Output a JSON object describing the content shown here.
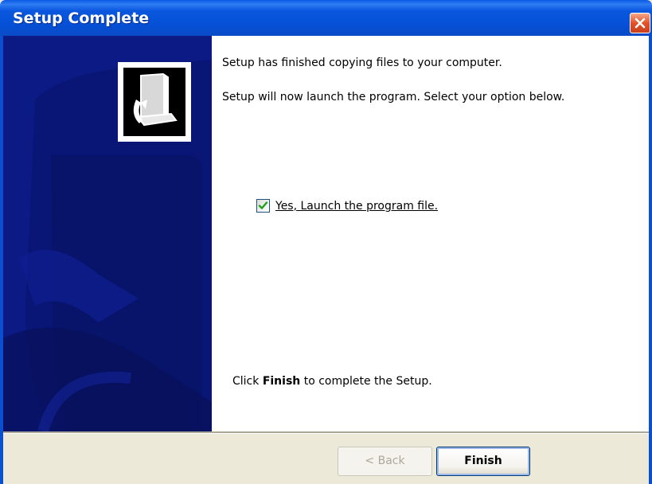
{
  "window": {
    "title": "Setup Complete"
  },
  "icons": {
    "close": "close-icon",
    "program": "program-install-icon",
    "checkmark": "checkmark-icon"
  },
  "content": {
    "line1": "Setup has finished copying files to your computer.",
    "line2": "Setup will now launch the program. Select your option below.",
    "launch_option": {
      "label": "Yes, Launch the program file.",
      "checked": true
    },
    "finish_prefix": "Click ",
    "finish_bold": "Finish",
    "finish_suffix": " to complete the Setup."
  },
  "buttons": {
    "back": "< Back",
    "finish": "Finish"
  },
  "colors": {
    "titlebar": "#0550d6",
    "side_panel": "#0c1a86",
    "dialog_bg": "#ece9d8",
    "check": "#21a121"
  }
}
